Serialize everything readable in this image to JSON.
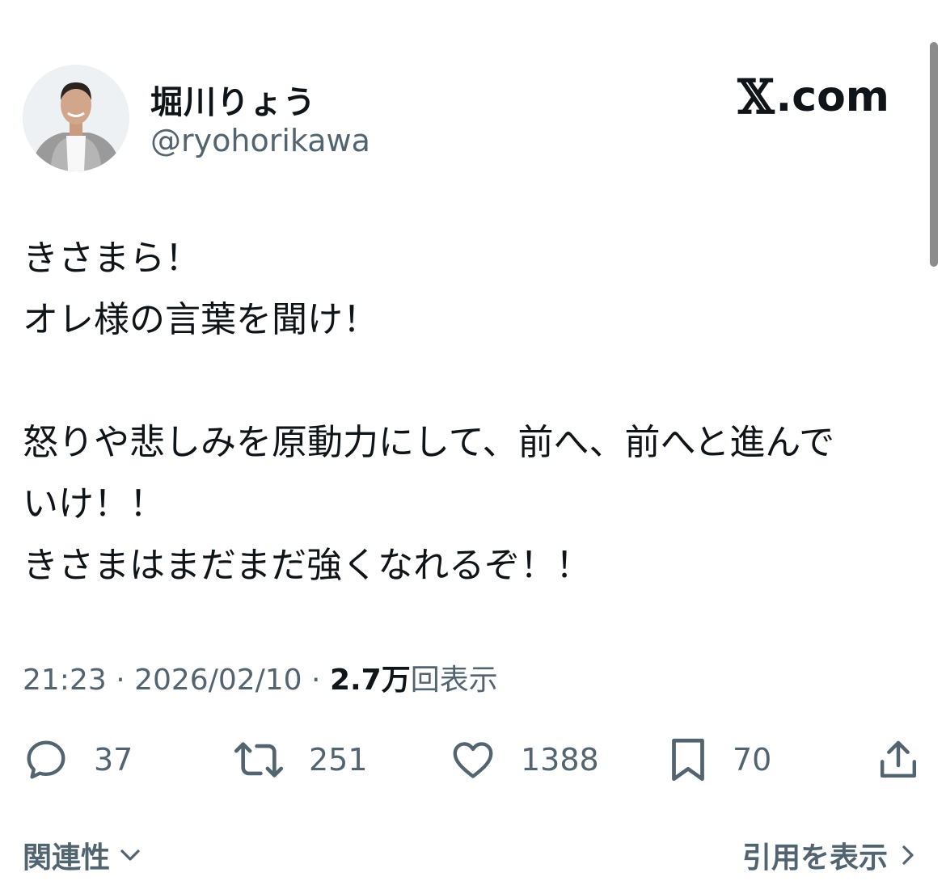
{
  "author": {
    "display_name": "堀川りょう",
    "handle": "@ryohorikawa"
  },
  "brand": {
    "mark": "𝕏",
    "domain": ".com"
  },
  "tweet": {
    "lines": [
      "きさまら！",
      "オレ様の言葉を聞け！",
      "",
      "怒りや悲しみを原動力にして、前へ、前へと進んで",
      "いけ！！",
      "きさまはまだまだ強くなれるぞ！！"
    ]
  },
  "meta": {
    "time": "21:23",
    "separator": " · ",
    "date": "2026/02/10",
    "views_count": "2.7万",
    "views_label": "回表示"
  },
  "actions": {
    "reply_count": "37",
    "retweet_count": "251",
    "like_count": "1388",
    "bookmark_count": "70"
  },
  "footer": {
    "related_label": "関連性",
    "quotes_label": "引用を表示"
  },
  "colors": {
    "text_primary": "#0f1419",
    "text_secondary": "#536471",
    "background": "#ffffff"
  }
}
